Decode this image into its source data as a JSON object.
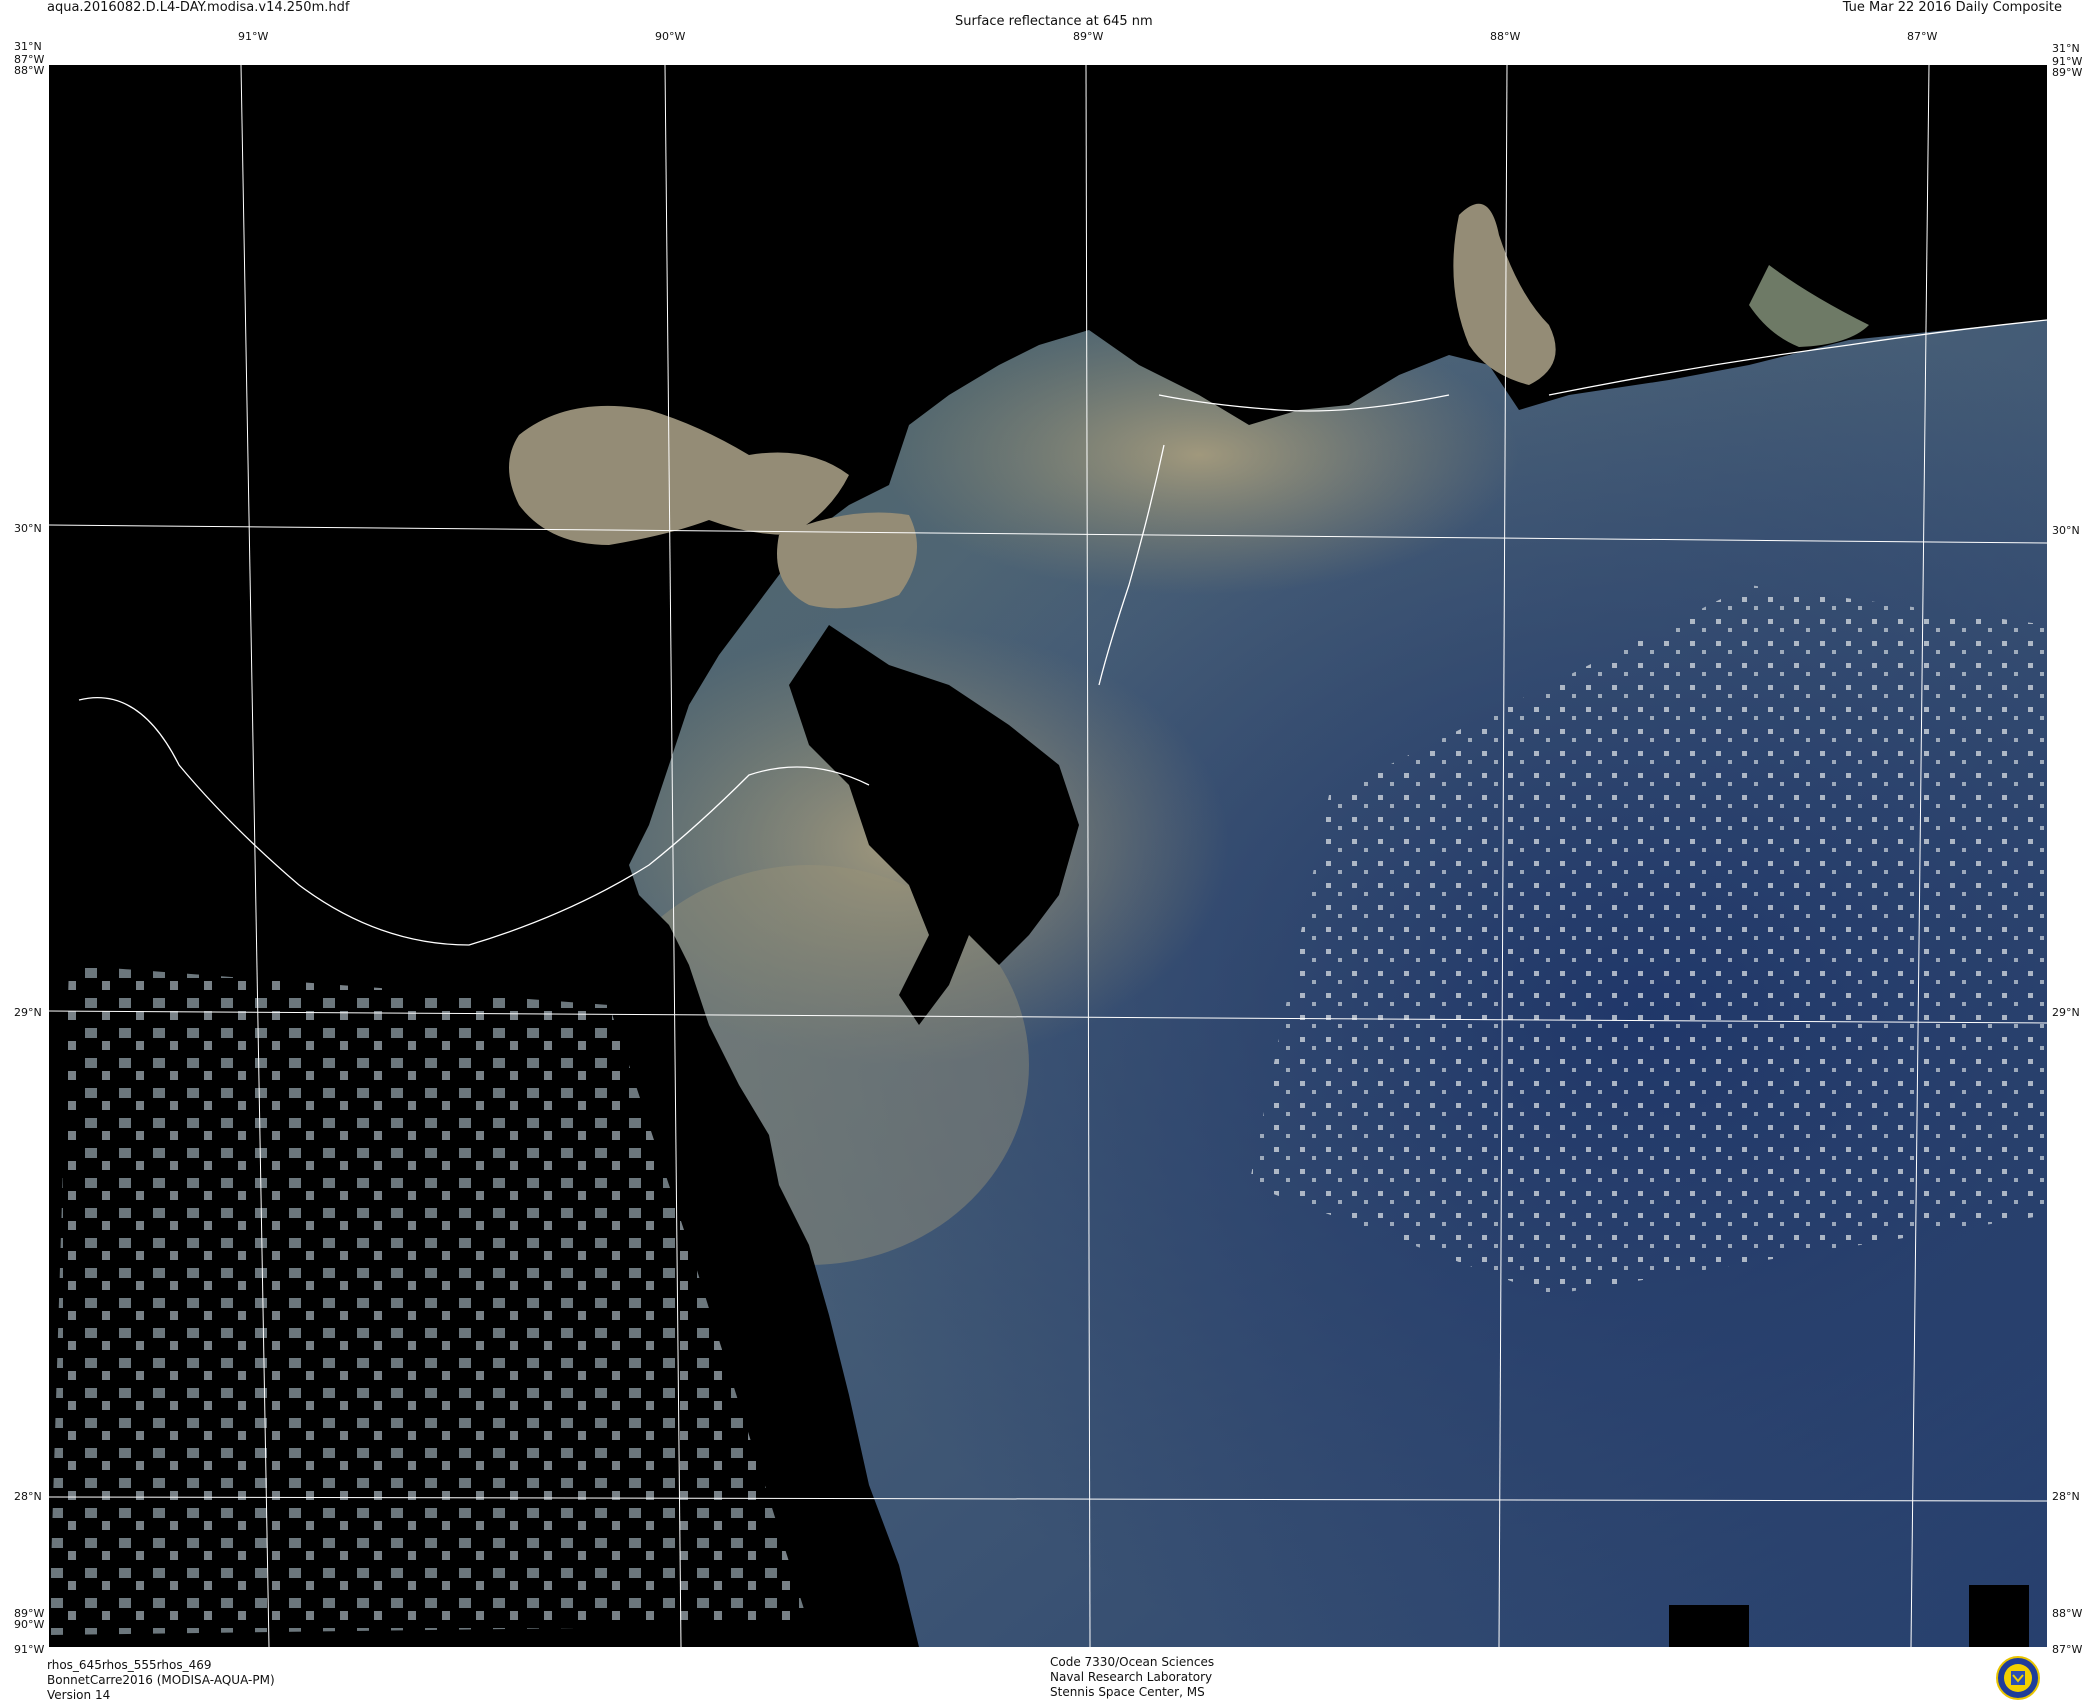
{
  "header": {
    "filename": "aqua.2016082.D.L4-DAY.modisa.v14.250m.hdf",
    "title": "Surface reflectance at 645 nm",
    "date": "Tue Mar 22 2016 Daily Composite"
  },
  "grid": {
    "top_lon_labels": [
      "91°W",
      "90°W",
      "89°W",
      "88°W",
      "87°W"
    ],
    "lat_labels": [
      "30°N",
      "29°N",
      "28°N"
    ],
    "corner_labels": {
      "top_left_lat": "31°N",
      "top_left_a": "87°W",
      "top_left_b": "88°W",
      "top_right_lat": "31°N",
      "top_right_a": "91°W",
      "top_right_b": "89°W",
      "bottom_left_a": "89°W",
      "bottom_left_b": "90°W",
      "bottom_left_c": "91°W",
      "bottom_right_a": "88°W",
      "bottom_right_b": "87°W"
    }
  },
  "footer": {
    "left": [
      "rhos_645rhos_555rhos_469",
      "BonnetCarre2016 (MODISA-AQUA-PM)",
      "Version 14"
    ],
    "center": [
      "Code 7330/Ocean Sciences",
      "Naval Research Laboratory",
      "Stennis Space Center, MS"
    ]
  },
  "colors": {
    "land": "#000000",
    "sediment_plume": "#9a9277",
    "coastal_green": "#5d6f56",
    "shelf_water": "#4e5f6e",
    "deep_water": "#22386a",
    "grid": "#ffffff"
  },
  "logo": {
    "icon": "nrl-seal-icon"
  }
}
